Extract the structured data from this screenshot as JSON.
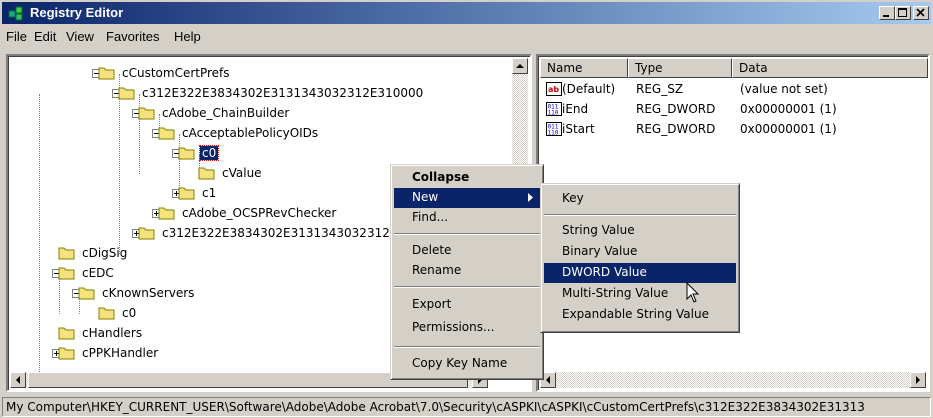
{
  "window": {
    "title": "Registry Editor"
  },
  "menubar": [
    "File",
    "Edit",
    "View",
    "Favorites",
    "Help"
  ],
  "tree": {
    "nodes": [
      "cCustomCertPrefs",
      "c312E322E3834302E3131343032312E310000",
      "cAdobe_ChainBuilder",
      "cAcceptablePolicyOIDs",
      "c0",
      "cValue",
      "c1",
      "cAdobe_OCSPRevChecker",
      "c312E322E3834302E3131343032312",
      "cDigSig",
      "cEDC",
      "cKnownServers",
      "c0",
      "cHandlers",
      "cPPKHandler"
    ]
  },
  "list": {
    "headers": [
      "Name",
      "Type",
      "Data"
    ],
    "rows": [
      {
        "name": "(Default)",
        "type": "REG_SZ",
        "data": "(value not set)",
        "icon": "string-value-icon"
      },
      {
        "name": "iEnd",
        "type": "REG_DWORD",
        "data": "0x00000001 (1)",
        "icon": "binary-value-icon"
      },
      {
        "name": "iStart",
        "type": "REG_DWORD",
        "data": "0x00000001 (1)",
        "icon": "binary-value-icon"
      }
    ]
  },
  "context_menu": {
    "items": [
      "Collapse",
      "New",
      "Find...",
      "Delete",
      "Rename",
      "Export",
      "Permissions...",
      "Copy Key Name"
    ]
  },
  "submenu": {
    "items": [
      "Key",
      "String Value",
      "Binary Value",
      "DWORD Value",
      "Multi-String Value",
      "Expandable String Value"
    ]
  },
  "status": "My Computer\\HKEY_CURRENT_USER\\Software\\Adobe\\Adobe Acrobat\\7.0\\Security\\cASPKI\\cASPKI\\cCustomCertPrefs\\c312E322E3834302E31313",
  "colors": {
    "title_start": "#0a246a",
    "title_end": "#a6caf0",
    "highlight": "#0a246a",
    "face": "#d4d0c8"
  }
}
